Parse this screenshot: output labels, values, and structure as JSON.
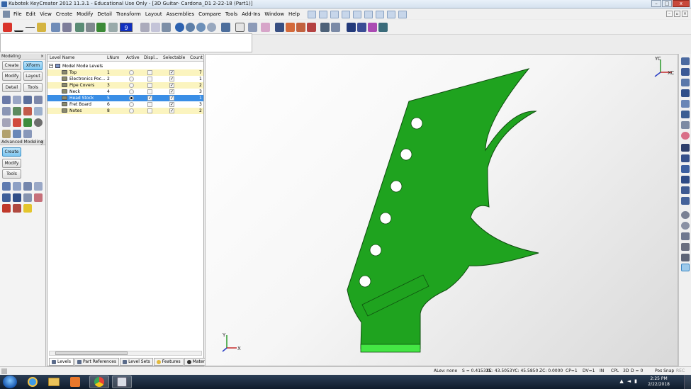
{
  "window": {
    "title": "Kubotek KeyCreator 2012 11.3.1 - Educational Use Only - [3D Guitar- Cardona_D1 2-22-18 (Part1)]",
    "minimize": "–",
    "maximize": "□",
    "close": "x"
  },
  "menu": [
    "File",
    "Edit",
    "View",
    "Create",
    "Modify",
    "Detail",
    "Transform",
    "Layout",
    "Assemblies",
    "Compare",
    "Tools",
    "Add-Ins",
    "Window",
    "Help"
  ],
  "mdi_controls": [
    "–",
    "▫",
    "×"
  ],
  "toolbar": {
    "level_number": "9"
  },
  "left_panel": {
    "modeling_header": "Modeling",
    "advanced_header": "Advanced Modeling",
    "close_glyph": "×",
    "modeling_buttons": {
      "create": "Create",
      "xform": "XForm",
      "modify": "Modify",
      "layout": "Layout",
      "detail": "Detail",
      "tools": "Tools"
    },
    "advanced_buttons": {
      "create": "Create",
      "modify": "Modify",
      "tools": "Tools"
    }
  },
  "levels": {
    "columns": {
      "name": "Level Name",
      "lnum": "LNum",
      "active": "Active",
      "display": "Displ...",
      "selectable": "Selectable",
      "count": "Count"
    },
    "root": "Model Mode Levels",
    "rows": [
      {
        "name": "Top",
        "lnum": "1",
        "count": "7",
        "active": false,
        "display": false,
        "selectable": true
      },
      {
        "name": "Electronics Poc...",
        "lnum": "2",
        "count": "1",
        "active": false,
        "display": false,
        "selectable": true
      },
      {
        "name": "Pipe Covers",
        "lnum": "3",
        "count": "2",
        "active": false,
        "display": false,
        "selectable": true
      },
      {
        "name": "Neck",
        "lnum": "4",
        "count": "3",
        "active": false,
        "display": false,
        "selectable": true
      },
      {
        "name": "Head Stock",
        "lnum": "5",
        "count": "1",
        "active": true,
        "display": true,
        "selectable": true
      },
      {
        "name": "Fret Board",
        "lnum": "6",
        "count": "3",
        "active": false,
        "display": false,
        "selectable": true
      },
      {
        "name": "Notes",
        "lnum": "8",
        "count": "2",
        "active": false,
        "display": false,
        "selectable": true
      }
    ],
    "tabs": [
      "Levels",
      "Part References",
      "Level Sets",
      "Features",
      "Materials"
    ]
  },
  "viewport": {
    "triad_top": {
      "y": "YC",
      "x": "XC"
    },
    "triad_bottom": {
      "y": "Y",
      "x": "X"
    },
    "colors": {
      "part": "#1fa31f",
      "part_dark": "#0f4d0f",
      "accent": "#44e644"
    }
  },
  "status": {
    "alev": "ALev: none",
    "s": "S = 0.415335",
    "xc": "XC: 43.5053",
    "yc": "YC: 45.5850",
    "zc": "ZC: 0.0000",
    "cp": "CP=1",
    "dv": "DV=1",
    "in": "IN",
    "cpl": "CPL",
    "mode": "3D",
    "d": "D = 0",
    "snap": "Pos Snap",
    "rec": "REC"
  },
  "taskbar": {
    "time": "2:25 PM",
    "date": "2/22/2018"
  }
}
